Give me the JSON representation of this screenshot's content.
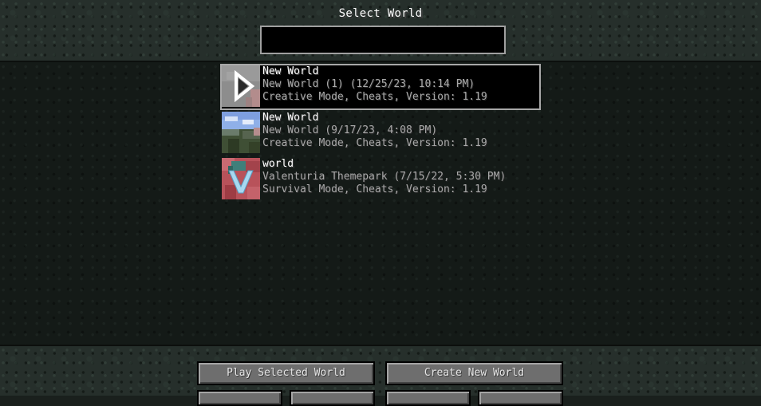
{
  "header": {
    "title": "Select World",
    "search": {
      "value": "",
      "placeholder": ""
    }
  },
  "worlds": [
    {
      "name": "New World",
      "folder_date": "New World (1) (12/25/23, 10:14 PM)",
      "details": "Creative Mode, Cheats, Version: 1.19",
      "selected": true,
      "thumbnail_icon": "play-arrow-icon"
    },
    {
      "name": "New World",
      "folder_date": "New World (9/17/23, 4:08 PM)",
      "details": "Creative Mode, Cheats, Version: 1.19",
      "selected": false,
      "thumbnail_icon": "landscape-thumbnail"
    },
    {
      "name": "world",
      "folder_date": "Valenturia Themepark (7/15/22, 5:30 PM)",
      "details": "Survival Mode, Cheats, Version: 1.19",
      "selected": false,
      "thumbnail_icon": "v-logo-thumbnail"
    }
  ],
  "buttons": {
    "play": "Play Selected World",
    "create": "Create New World",
    "edit": "",
    "delete": "",
    "recreate": "",
    "cancel": ""
  },
  "colors": {
    "background_band": "#262f2b",
    "list_background": "#141a17",
    "selection_border": "#a8a8a8",
    "button_face": "#6e6e6e",
    "primary_text": "#ffffff",
    "secondary_text": "#a8a8a8"
  }
}
